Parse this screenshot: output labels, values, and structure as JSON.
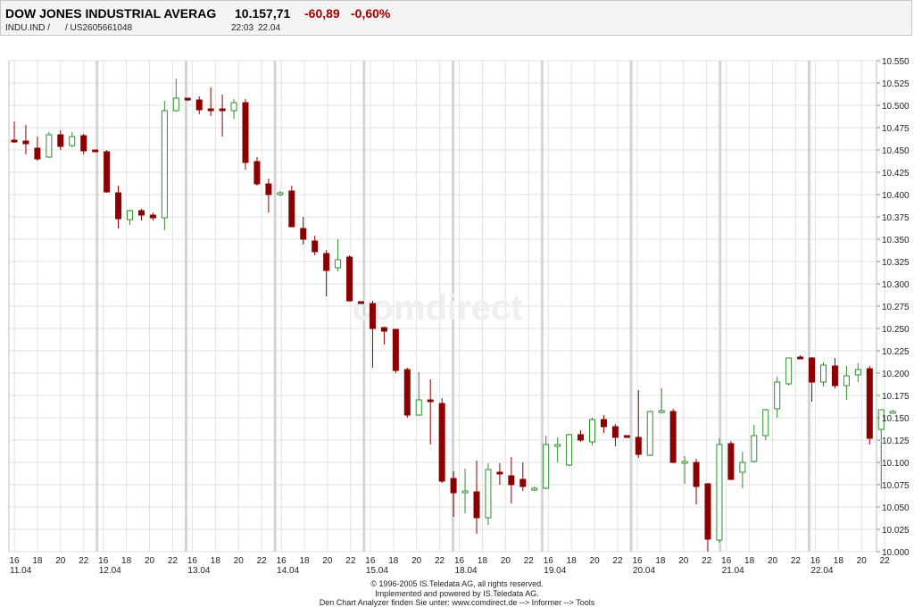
{
  "header": {
    "name": "DOW JONES INDUSTRIAL AVERAG",
    "price": "10.157,71",
    "change": "-60,89",
    "change_pct": "-0,60%",
    "symbol": "INDU.IND  /",
    "isin": "/  US2605661048",
    "time": "22:03",
    "date": "22.04"
  },
  "watermark": "comdirect",
  "footer": {
    "line1": "© 1996-2005 IS.Teledata AG, all rights reserved.",
    "line2": "Implemented and powered by IS.Teledata AG.",
    "line3": "Den Chart Analyzer finden Sie unter: www.comdirect.de --> Informer --> Tools"
  },
  "colors": {
    "up": "#2f8f2f",
    "down": "#8b0000",
    "grid": "#e2e2e2",
    "session": "#d4d4d4"
  },
  "chart_data": {
    "type": "candlestick",
    "title": "DOW JONES INDUSTRIAL AVERAG",
    "ylim": [
      10000,
      10550
    ],
    "y_ticks": [
      "10.550",
      "10.525",
      "10.500",
      "10.475",
      "10.450",
      "10.425",
      "10.400",
      "10.375",
      "10.350",
      "10.325",
      "10.300",
      "10.275",
      "10.250",
      "10.225",
      "10.200",
      "10.175",
      "10.150",
      "10.125",
      "10.100",
      "10.075",
      "10.050",
      "10.025",
      "10.000"
    ],
    "days": [
      "11.04",
      "12.04",
      "13.04",
      "14.04",
      "15.04",
      "18.04",
      "19.04",
      "20.04",
      "21.04",
      "22.04"
    ],
    "hour_labels": [
      "16",
      "18",
      "20",
      "22"
    ],
    "candles": [
      {
        "o": 10461,
        "h": 10482,
        "l": 10458,
        "c": 10460
      },
      {
        "o": 10460,
        "h": 10478,
        "l": 10445,
        "c": 10457
      },
      {
        "o": 10452,
        "h": 10465,
        "l": 10438,
        "c": 10440
      },
      {
        "o": 10442,
        "h": 10470,
        "l": 10441,
        "c": 10467
      },
      {
        "o": 10467,
        "h": 10472,
        "l": 10450,
        "c": 10454
      },
      {
        "o": 10455,
        "h": 10470,
        "l": 10453,
        "c": 10465
      },
      {
        "o": 10466,
        "h": 10468,
        "l": 10445,
        "c": 10449
      },
      {
        "o": 10450,
        "h": 10450,
        "l": 10448,
        "c": 10449
      },
      {
        "o": 10448,
        "h": 10450,
        "l": 10402,
        "c": 10403
      },
      {
        "o": 10402,
        "h": 10410,
        "l": 10362,
        "c": 10373
      },
      {
        "o": 10372,
        "h": 10383,
        "l": 10366,
        "c": 10382
      },
      {
        "o": 10382,
        "h": 10384,
        "l": 10371,
        "c": 10377
      },
      {
        "o": 10377,
        "h": 10380,
        "l": 10371,
        "c": 10374
      },
      {
        "o": 10374,
        "h": 10505,
        "l": 10360,
        "c": 10494
      },
      {
        "o": 10494,
        "h": 10530,
        "l": 10493,
        "c": 10508
      },
      {
        "o": 10508,
        "h": 10508,
        "l": 10505,
        "c": 10507
      },
      {
        "o": 10506,
        "h": 10510,
        "l": 10490,
        "c": 10495
      },
      {
        "o": 10496,
        "h": 10520,
        "l": 10488,
        "c": 10495
      },
      {
        "o": 10496,
        "h": 10512,
        "l": 10465,
        "c": 10495
      },
      {
        "o": 10494,
        "h": 10507,
        "l": 10485,
        "c": 10503
      },
      {
        "o": 10503,
        "h": 10507,
        "l": 10428,
        "c": 10436
      },
      {
        "o": 10437,
        "h": 10442,
        "l": 10410,
        "c": 10412
      },
      {
        "o": 10412,
        "h": 10418,
        "l": 10380,
        "c": 10400
      },
      {
        "o": 10400,
        "h": 10404,
        "l": 10398,
        "c": 10402
      },
      {
        "o": 10404,
        "h": 10410,
        "l": 10364,
        "c": 10364
      },
      {
        "o": 10362,
        "h": 10375,
        "l": 10344,
        "c": 10350
      },
      {
        "o": 10348,
        "h": 10354,
        "l": 10332,
        "c": 10336
      },
      {
        "o": 10334,
        "h": 10338,
        "l": 10286,
        "c": 10315
      },
      {
        "o": 10318,
        "h": 10350,
        "l": 10314,
        "c": 10327
      },
      {
        "o": 10330,
        "h": 10332,
        "l": 10280,
        "c": 10281
      },
      {
        "o": 10280,
        "h": 10280,
        "l": 10278,
        "c": 10279
      },
      {
        "o": 10278,
        "h": 10281,
        "l": 10206,
        "c": 10250
      },
      {
        "o": 10251,
        "h": 10252,
        "l": 10232,
        "c": 10247
      },
      {
        "o": 10249,
        "h": 10249,
        "l": 10200,
        "c": 10203
      },
      {
        "o": 10204,
        "h": 10206,
        "l": 10150,
        "c": 10153
      },
      {
        "o": 10153,
        "h": 10201,
        "l": 10152,
        "c": 10170
      },
      {
        "o": 10170,
        "h": 10193,
        "l": 10120,
        "c": 10168
      },
      {
        "o": 10166,
        "h": 10172,
        "l": 10077,
        "c": 10079
      },
      {
        "o": 10082,
        "h": 10090,
        "l": 10039,
        "c": 10066
      },
      {
        "o": 10068,
        "h": 10093,
        "l": 10043,
        "c": 10068
      },
      {
        "o": 10067,
        "h": 10102,
        "l": 10020,
        "c": 10038
      },
      {
        "o": 10038,
        "h": 10099,
        "l": 10030,
        "c": 10092
      },
      {
        "o": 10089,
        "h": 10099,
        "l": 10075,
        "c": 10087
      },
      {
        "o": 10085,
        "h": 10106,
        "l": 10054,
        "c": 10075
      },
      {
        "o": 10081,
        "h": 10100,
        "l": 10068,
        "c": 10073
      },
      {
        "o": 10071,
        "h": 10073,
        "l": 10068,
        "c": 10071
      },
      {
        "o": 10071,
        "h": 10130,
        "l": 10070,
        "c": 10120
      },
      {
        "o": 10120,
        "h": 10128,
        "l": 10100,
        "c": 10120
      },
      {
        "o": 10097,
        "h": 10132,
        "l": 10096,
        "c": 10131
      },
      {
        "o": 10131,
        "h": 10136,
        "l": 10123,
        "c": 10125
      },
      {
        "o": 10123,
        "h": 10150,
        "l": 10119,
        "c": 10148
      },
      {
        "o": 10148,
        "h": 10153,
        "l": 10133,
        "c": 10140
      },
      {
        "o": 10140,
        "h": 10143,
        "l": 10118,
        "c": 10128
      },
      {
        "o": 10130,
        "h": 10130,
        "l": 10128,
        "c": 10129
      },
      {
        "o": 10128,
        "h": 10181,
        "l": 10105,
        "c": 10109
      },
      {
        "o": 10108,
        "h": 10158,
        "l": 10107,
        "c": 10157
      },
      {
        "o": 10157,
        "h": 10183,
        "l": 10155,
        "c": 10158
      },
      {
        "o": 10157,
        "h": 10160,
        "l": 10099,
        "c": 10100
      },
      {
        "o": 10100,
        "h": 10107,
        "l": 10076,
        "c": 10101
      },
      {
        "o": 10100,
        "h": 10104,
        "l": 10053,
        "c": 10073
      },
      {
        "o": 10076,
        "h": 10077,
        "l": 10000,
        "c": 10014
      },
      {
        "o": 10013,
        "h": 10127,
        "l": 10010,
        "c": 10120
      },
      {
        "o": 10121,
        "h": 10124,
        "l": 10080,
        "c": 10081
      },
      {
        "o": 10089,
        "h": 10112,
        "l": 10071,
        "c": 10100
      },
      {
        "o": 10101,
        "h": 10142,
        "l": 10100,
        "c": 10130
      },
      {
        "o": 10130,
        "h": 10160,
        "l": 10125,
        "c": 10159
      },
      {
        "o": 10160,
        "h": 10196,
        "l": 10150,
        "c": 10190
      },
      {
        "o": 10188,
        "h": 10215,
        "l": 10186,
        "c": 10217
      },
      {
        "o": 10218,
        "h": 10220,
        "l": 10216,
        "c": 10217
      },
      {
        "o": 10217,
        "h": 10218,
        "l": 10168,
        "c": 10190
      },
      {
        "o": 10190,
        "h": 10212,
        "l": 10185,
        "c": 10209
      },
      {
        "o": 10208,
        "h": 10217,
        "l": 10183,
        "c": 10186
      },
      {
        "o": 10186,
        "h": 10208,
        "l": 10170,
        "c": 10197
      },
      {
        "o": 10198,
        "h": 10211,
        "l": 10190,
        "c": 10204
      },
      {
        "o": 10205,
        "h": 10208,
        "l": 10120,
        "c": 10127
      },
      {
        "o": 10137,
        "h": 10159,
        "l": 10070,
        "c": 10159
      },
      {
        "o": 10157,
        "h": 10159,
        "l": 10155,
        "c": 10157
      }
    ]
  }
}
